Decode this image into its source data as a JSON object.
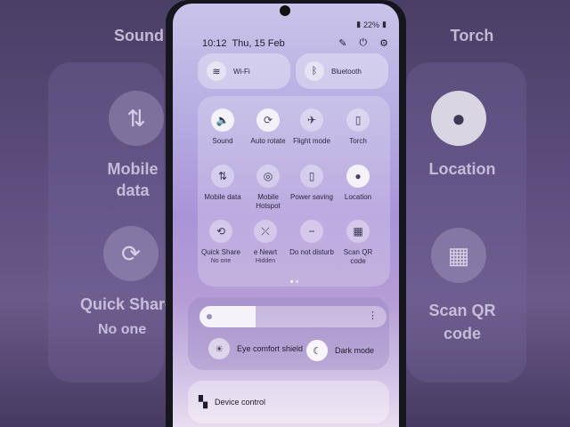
{
  "status": {
    "battery": "22%",
    "time": "10:12",
    "date": "Thu, 15 Feb"
  },
  "connectivity": {
    "wifi_label": "Wi-Fi",
    "bluetooth_label": "Bluetooth"
  },
  "quick_settings": {
    "sound": "Sound",
    "auto_rotate": "Auto rotate",
    "flight_mode": "Flight mode",
    "torch": "Torch",
    "mobile_data": "Mobile data",
    "mobile_hotspot": "Mobile Hotspot",
    "power_saving": "Power saving",
    "location": "Location",
    "quick_share": "Quick Share",
    "quick_share_sub": "No one",
    "nearby": "e Neart",
    "nearby_sub": "Hidden",
    "dnd": "Do not disturb",
    "scan_qr": "Scan QR code"
  },
  "display": {
    "brightness_percent": 30,
    "eye_comfort": "Eye comfort shield",
    "dark_mode": "Dark mode"
  },
  "device_control": {
    "label": "Device control"
  },
  "background": {
    "left": [
      "Sound",
      "Mobile data",
      "Quick Share",
      "No one"
    ],
    "right": [
      "Torch",
      "Location",
      "Scan QR code"
    ]
  }
}
